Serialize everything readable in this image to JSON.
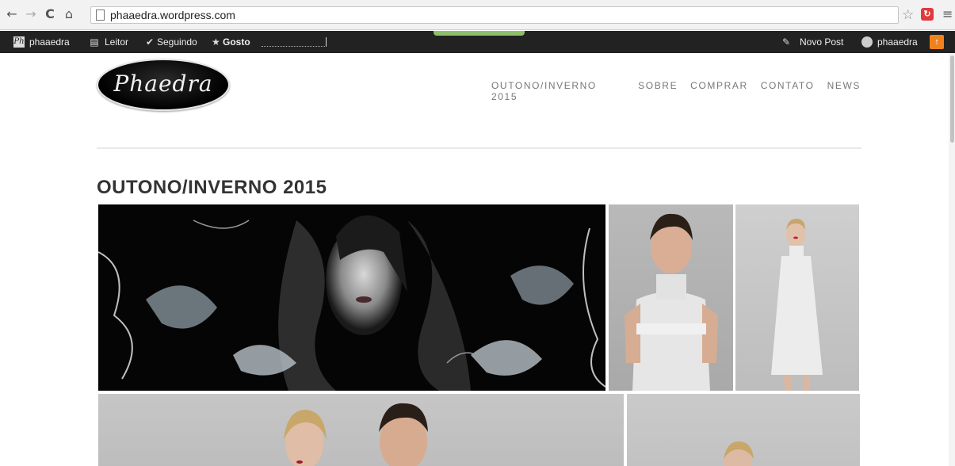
{
  "browser": {
    "url": "phaaedra.wordpress.com",
    "back_icon": "arrow-left-icon",
    "forward_icon": "arrow-right-icon",
    "reload_icon": "reload-icon",
    "home_icon": "home-icon"
  },
  "adminbar": {
    "site_name": "phaaedra",
    "reader_label": "Leitor",
    "following_label": "Seguindo",
    "likes_label": "Gosto",
    "new_post_label": "Novo Post",
    "user_name": "phaaedra",
    "color_bg": "#222222",
    "color_notify": "#f0821e"
  },
  "site": {
    "logo_text": "Phaedra",
    "nav": [
      "OUTONO/INVERNO 2015",
      "SOBRE",
      "COMPRAR",
      "CONTATO",
      "NEWS"
    ]
  },
  "page": {
    "title": "OUTONO/INVERNO 2015"
  }
}
